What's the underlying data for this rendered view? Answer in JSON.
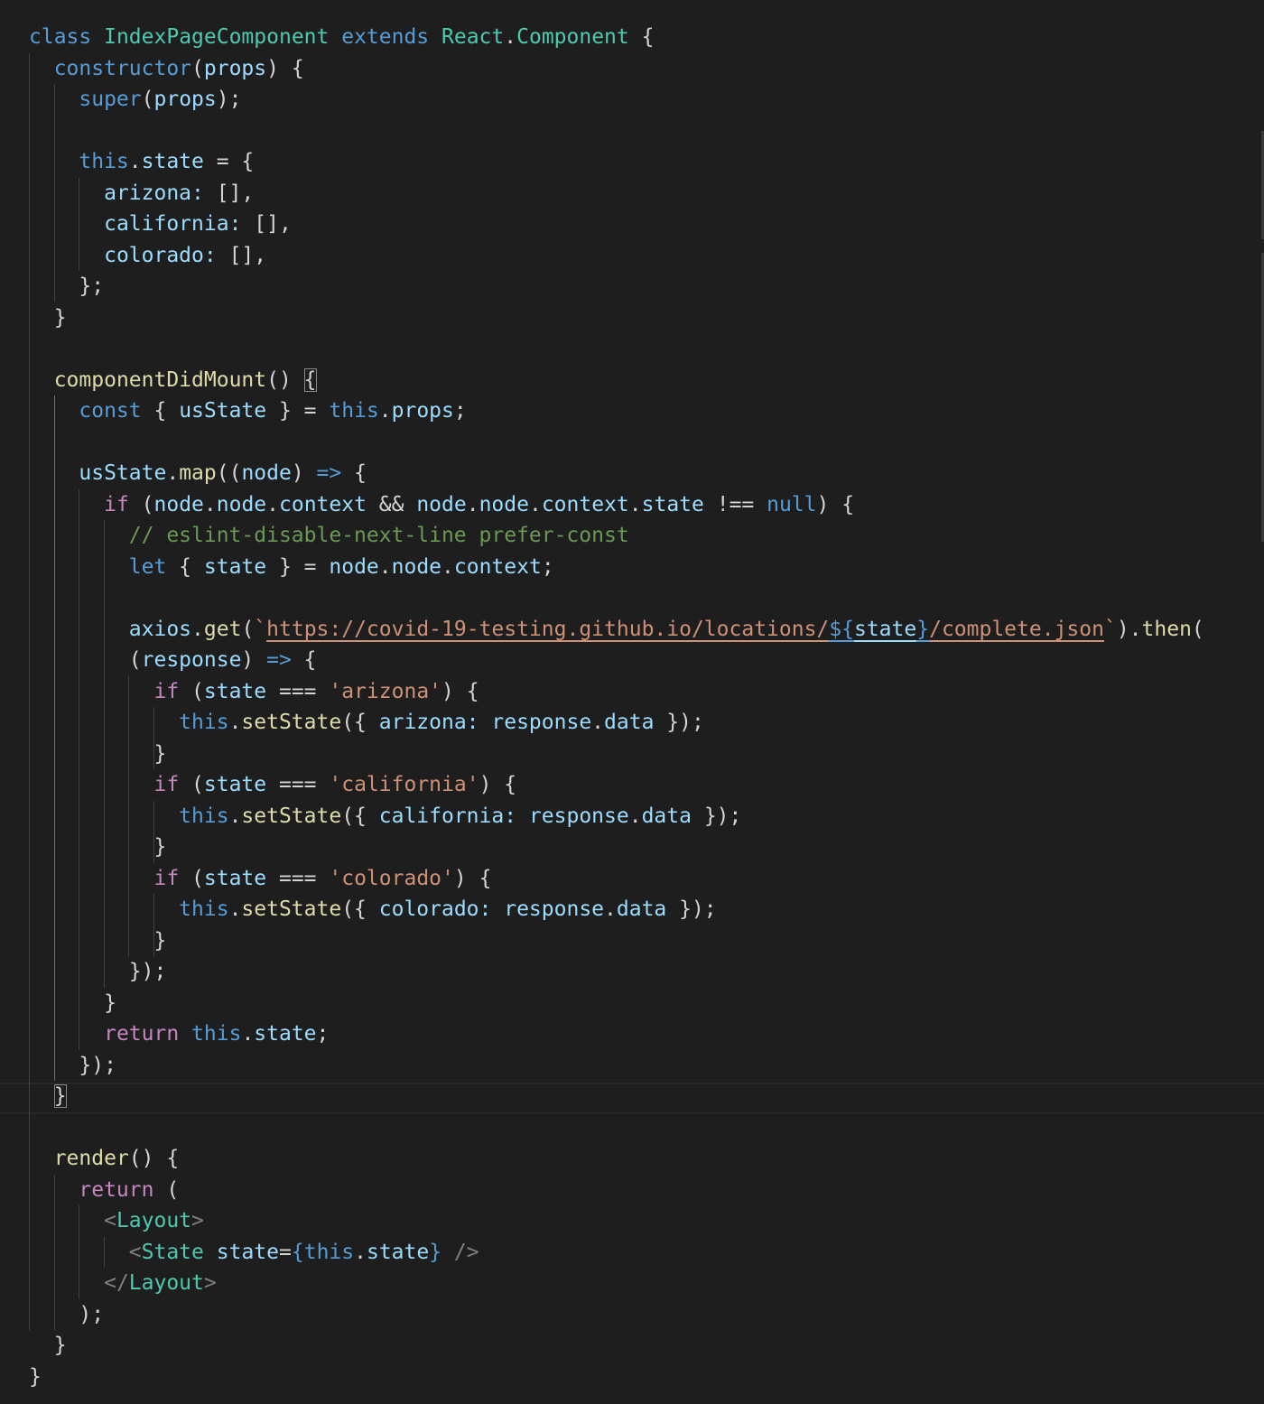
{
  "editor": {
    "language": "javascript",
    "theme": {
      "background": "#1e1e1e",
      "keyword": "#569cd6",
      "control": "#c586c0",
      "class_name": "#4ec9b0",
      "function": "#dcdcaa",
      "variable": "#9cdcfe",
      "string": "#ce9178",
      "comment": "#6a9955",
      "punctuation": "#d4d4d4",
      "tag_bracket": "#808080"
    },
    "lines": [
      [
        [
          "class",
          "kw"
        ],
        [
          " ",
          "p"
        ],
        [
          "IndexPageComponent",
          "cls"
        ],
        [
          " ",
          "p"
        ],
        [
          "extends",
          "kw"
        ],
        [
          " ",
          "p"
        ],
        [
          "React",
          "cls"
        ],
        [
          ".",
          "p"
        ],
        [
          "Component",
          "cls"
        ],
        [
          " {",
          "p"
        ]
      ],
      [
        [
          "  ",
          "p"
        ],
        [
          "constructor",
          "kw"
        ],
        [
          "(",
          "p"
        ],
        [
          "props",
          "var"
        ],
        [
          ") {",
          "p"
        ]
      ],
      [
        [
          "    ",
          "p"
        ],
        [
          "super",
          "kw"
        ],
        [
          "(",
          "p"
        ],
        [
          "props",
          "var"
        ],
        [
          ");",
          "p"
        ]
      ],
      [],
      [
        [
          "    ",
          "p"
        ],
        [
          "this",
          "kw"
        ],
        [
          ".",
          "p"
        ],
        [
          "state",
          "var"
        ],
        [
          " = {",
          "p"
        ]
      ],
      [
        [
          "      ",
          "p"
        ],
        [
          "arizona:",
          "var"
        ],
        [
          " [],",
          "p"
        ]
      ],
      [
        [
          "      ",
          "p"
        ],
        [
          "california:",
          "var"
        ],
        [
          " [],",
          "p"
        ]
      ],
      [
        [
          "      ",
          "p"
        ],
        [
          "colorado:",
          "var"
        ],
        [
          " [],",
          "p"
        ]
      ],
      [
        [
          "    };",
          "p"
        ]
      ],
      [
        [
          "  }",
          "p"
        ]
      ],
      [],
      [
        [
          "  ",
          "p"
        ],
        [
          "componentDidMount",
          "fn"
        ],
        [
          "() ",
          "p"
        ],
        [
          "{",
          "p bm"
        ]
      ],
      [
        [
          "    ",
          "p"
        ],
        [
          "const",
          "kw"
        ],
        [
          " { ",
          "p"
        ],
        [
          "usState",
          "var"
        ],
        [
          " } = ",
          "p"
        ],
        [
          "this",
          "kw"
        ],
        [
          ".",
          "p"
        ],
        [
          "props",
          "var"
        ],
        [
          ";",
          "p"
        ]
      ],
      [],
      [
        [
          "    ",
          "p"
        ],
        [
          "usState",
          "var"
        ],
        [
          ".",
          "p"
        ],
        [
          "map",
          "fn"
        ],
        [
          "((",
          "p"
        ],
        [
          "node",
          "var"
        ],
        [
          ") ",
          "p"
        ],
        [
          "=>",
          "kw"
        ],
        [
          " {",
          "p"
        ]
      ],
      [
        [
          "      ",
          "p"
        ],
        [
          "if",
          "ctl"
        ],
        [
          " (",
          "p"
        ],
        [
          "node",
          "var"
        ],
        [
          ".",
          "p"
        ],
        [
          "node",
          "var"
        ],
        [
          ".",
          "p"
        ],
        [
          "context",
          "var"
        ],
        [
          " && ",
          "p"
        ],
        [
          "node",
          "var"
        ],
        [
          ".",
          "p"
        ],
        [
          "node",
          "var"
        ],
        [
          ".",
          "p"
        ],
        [
          "context",
          "var"
        ],
        [
          ".",
          "p"
        ],
        [
          "state",
          "var"
        ],
        [
          " !== ",
          "p"
        ],
        [
          "null",
          "kw"
        ],
        [
          ") {",
          "p"
        ]
      ],
      [
        [
          "        ",
          "p"
        ],
        [
          "// eslint-disable-next-line prefer-const",
          "cmt"
        ]
      ],
      [
        [
          "        ",
          "p"
        ],
        [
          "let",
          "kw"
        ],
        [
          " { ",
          "p"
        ],
        [
          "state",
          "var"
        ],
        [
          " } = ",
          "p"
        ],
        [
          "node",
          "var"
        ],
        [
          ".",
          "p"
        ],
        [
          "node",
          "var"
        ],
        [
          ".",
          "p"
        ],
        [
          "context",
          "var"
        ],
        [
          ";",
          "p"
        ]
      ],
      [],
      [
        [
          "        ",
          "p"
        ],
        [
          "axios",
          "var"
        ],
        [
          ".",
          "p"
        ],
        [
          "get",
          "fn"
        ],
        [
          "(",
          "p"
        ],
        [
          "`",
          "str"
        ],
        [
          "https://covid-19-testing.github.io/locations/",
          "str url"
        ],
        [
          "${",
          "kw url"
        ],
        [
          "state",
          "var url"
        ],
        [
          "}",
          "kw url"
        ],
        [
          "/complete.json",
          "str url"
        ],
        [
          "`",
          "str"
        ],
        [
          ").",
          "p"
        ],
        [
          "then",
          "fn"
        ],
        [
          "(",
          "p"
        ]
      ],
      [
        [
          "        ",
          "p"
        ],
        [
          "(",
          "p"
        ],
        [
          "response",
          "var"
        ],
        [
          ") ",
          "p"
        ],
        [
          "=>",
          "kw"
        ],
        [
          " {",
          "p"
        ]
      ],
      [
        [
          "          ",
          "p"
        ],
        [
          "if",
          "ctl"
        ],
        [
          " (",
          "p"
        ],
        [
          "state",
          "var"
        ],
        [
          " === ",
          "p"
        ],
        [
          "'arizona'",
          "str"
        ],
        [
          ") {",
          "p"
        ]
      ],
      [
        [
          "            ",
          "p"
        ],
        [
          "this",
          "kw"
        ],
        [
          ".",
          "p"
        ],
        [
          "setState",
          "fn"
        ],
        [
          "({ ",
          "p"
        ],
        [
          "arizona:",
          "var"
        ],
        [
          " ",
          "p"
        ],
        [
          "response",
          "var"
        ],
        [
          ".",
          "p"
        ],
        [
          "data",
          "var"
        ],
        [
          " });",
          "p"
        ]
      ],
      [
        [
          "          }",
          "p"
        ]
      ],
      [
        [
          "          ",
          "p"
        ],
        [
          "if",
          "ctl"
        ],
        [
          " (",
          "p"
        ],
        [
          "state",
          "var"
        ],
        [
          " === ",
          "p"
        ],
        [
          "'california'",
          "str"
        ],
        [
          ") {",
          "p"
        ]
      ],
      [
        [
          "            ",
          "p"
        ],
        [
          "this",
          "kw"
        ],
        [
          ".",
          "p"
        ],
        [
          "setState",
          "fn"
        ],
        [
          "({ ",
          "p"
        ],
        [
          "california:",
          "var"
        ],
        [
          " ",
          "p"
        ],
        [
          "response",
          "var"
        ],
        [
          ".",
          "p"
        ],
        [
          "data",
          "var"
        ],
        [
          " });",
          "p"
        ]
      ],
      [
        [
          "          }",
          "p"
        ]
      ],
      [
        [
          "          ",
          "p"
        ],
        [
          "if",
          "ctl"
        ],
        [
          " (",
          "p"
        ],
        [
          "state",
          "var"
        ],
        [
          " === ",
          "p"
        ],
        [
          "'colorado'",
          "str"
        ],
        [
          ") {",
          "p"
        ]
      ],
      [
        [
          "            ",
          "p"
        ],
        [
          "this",
          "kw"
        ],
        [
          ".",
          "p"
        ],
        [
          "setState",
          "fn"
        ],
        [
          "({ ",
          "p"
        ],
        [
          "colorado:",
          "var"
        ],
        [
          " ",
          "p"
        ],
        [
          "response",
          "var"
        ],
        [
          ".",
          "p"
        ],
        [
          "data",
          "var"
        ],
        [
          " });",
          "p"
        ]
      ],
      [
        [
          "          }",
          "p"
        ]
      ],
      [
        [
          "        });",
          "p"
        ]
      ],
      [
        [
          "      }",
          "p"
        ]
      ],
      [
        [
          "      ",
          "p"
        ],
        [
          "return",
          "ctl"
        ],
        [
          " ",
          "p"
        ],
        [
          "this",
          "kw"
        ],
        [
          ".",
          "p"
        ],
        [
          "state",
          "var"
        ],
        [
          ";",
          "p"
        ]
      ],
      [
        [
          "    });",
          "p"
        ]
      ],
      [
        [
          "  ",
          "p"
        ],
        [
          "}",
          "p bm"
        ]
      ],
      [],
      [
        [
          "  ",
          "p"
        ],
        [
          "render",
          "fn"
        ],
        [
          "() {",
          "p"
        ]
      ],
      [
        [
          "    ",
          "p"
        ],
        [
          "return",
          "ctl"
        ],
        [
          " (",
          "p"
        ]
      ],
      [
        [
          "      ",
          "p"
        ],
        [
          "<",
          "tag"
        ],
        [
          "Layout",
          "cls"
        ],
        [
          ">",
          "tag"
        ]
      ],
      [
        [
          "        ",
          "p"
        ],
        [
          "<",
          "tag"
        ],
        [
          "State",
          "cls"
        ],
        [
          " ",
          "p"
        ],
        [
          "state",
          "var"
        ],
        [
          "=",
          "p"
        ],
        [
          "{",
          "kw"
        ],
        [
          "this",
          "kw"
        ],
        [
          ".",
          "p"
        ],
        [
          "state",
          "var"
        ],
        [
          "}",
          "kw"
        ],
        [
          " />",
          "tag"
        ]
      ],
      [
        [
          "      ",
          "p"
        ],
        [
          "</",
          "tag"
        ],
        [
          "Layout",
          "cls"
        ],
        [
          ">",
          "tag"
        ]
      ],
      [
        [
          "    );",
          "p"
        ]
      ],
      [
        [
          "  }",
          "p"
        ]
      ],
      [
        [
          "}",
          "p"
        ]
      ]
    ]
  }
}
